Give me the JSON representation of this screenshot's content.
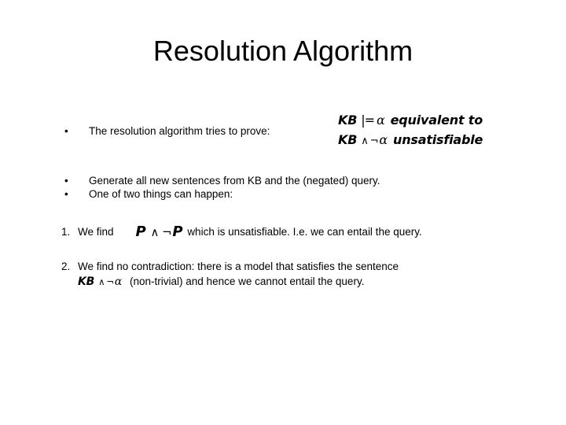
{
  "slide": {
    "title": "Resolution Algorithm",
    "background_color": "#ffffff",
    "text_color": "#000000"
  },
  "bullets": [
    {
      "marker": "•",
      "text": "The resolution algorithm tries to prove:"
    },
    {
      "marker": "•",
      "text": "Generate all new sentences from KB and the (negated) query."
    },
    {
      "marker": "•",
      "text": "One of two things can happen:"
    }
  ],
  "formula": {
    "line1": {
      "kb": "KB",
      "entails": "|=",
      "alpha": "α",
      "tail": "equivalent to"
    },
    "line2": {
      "kb": "KB",
      "and": "∧",
      "not": "¬",
      "alpha": "α",
      "tail": "unsatisfiable"
    }
  },
  "numbered": [
    {
      "label": "1.",
      "lead": "We find",
      "math": {
        "p1": "P",
        "and": "∧",
        "not": "¬",
        "p2": "P"
      },
      "tail": "which is unsatisfiable. I.e. we can entail the query."
    },
    {
      "label": "2.",
      "line1": "We find no contradiction: there is a model that satisfies the sentence",
      "math": {
        "kb": "KB",
        "and": "∧",
        "not": "¬",
        "alpha": "α"
      },
      "tail": "(non-trivial) and hence we cannot entail the query."
    }
  ]
}
